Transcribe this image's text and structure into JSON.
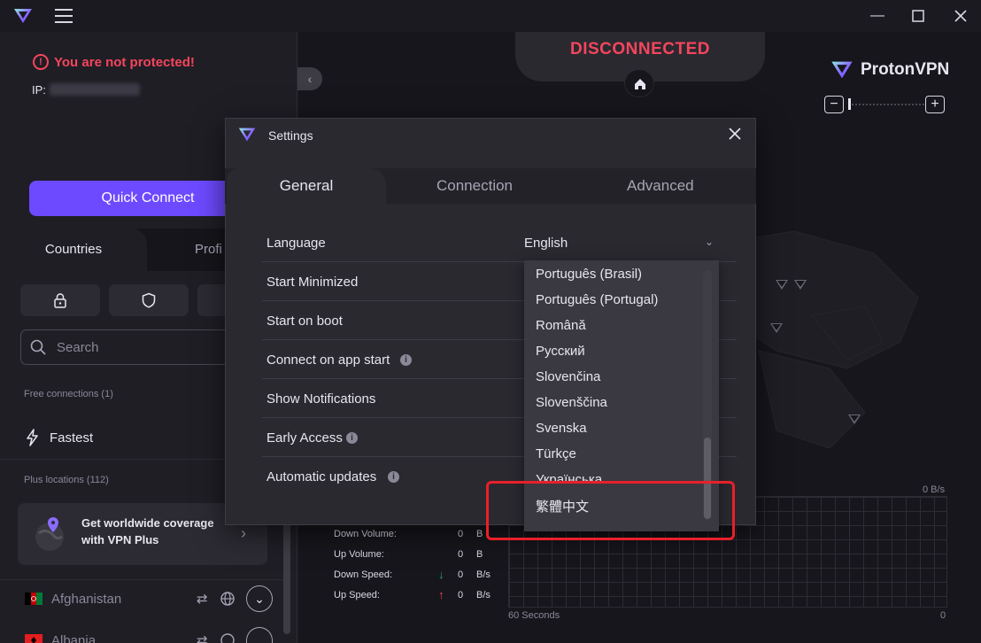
{
  "app": {
    "brand": "ProtonVPN",
    "colors": {
      "accent": "#6d4aff",
      "danger": "#f5455c",
      "highlight": "#e8202a"
    }
  },
  "window": {
    "minimize_icon": "minimize-icon",
    "maximize_icon": "maximize-icon",
    "close_icon": "close-icon"
  },
  "sidebar": {
    "warning": "You are not protected!",
    "ip_label": "IP:",
    "quick_connect": "Quick Connect",
    "tabs": [
      {
        "label": "Countries",
        "active": true
      },
      {
        "label": "Profiles",
        "display": "Profi",
        "active": false
      }
    ],
    "filters": [
      "lock-icon",
      "shield-icon",
      "filter-icon"
    ],
    "search_placeholder": "Search",
    "free_section": "Free connections (1)",
    "fastest": "Fastest",
    "plus_section": "Plus locations (112)",
    "upsell": {
      "line1": "Get worldwide coverage",
      "line2": "with VPN Plus"
    },
    "countries": [
      {
        "name": "Afghanistan",
        "flag": "af"
      },
      {
        "name": "Albania",
        "flag": "al"
      }
    ]
  },
  "map": {
    "status": "DISCONNECTED",
    "zoom_out": "−",
    "zoom_in": "+",
    "stats": [
      {
        "label": "Down Volume:",
        "value": "0",
        "unit": "B"
      },
      {
        "label": "Up Volume:",
        "value": "0",
        "unit": "B"
      },
      {
        "label": "Down Speed:",
        "value": "0",
        "unit": "B/s",
        "arrow": "↓"
      },
      {
        "label": "Up Speed:",
        "value": "0",
        "unit": "B/s",
        "arrow": "↑"
      }
    ],
    "graph": {
      "top_right": "0 B/s",
      "bottom_left": "60 Seconds",
      "bottom_right": "0"
    }
  },
  "settings": {
    "title": "Settings",
    "tabs": [
      {
        "label": "General",
        "active": true
      },
      {
        "label": "Connection",
        "active": false
      },
      {
        "label": "Advanced",
        "active": false
      }
    ],
    "rows": [
      {
        "label": "Language",
        "info": false
      },
      {
        "label": "Start Minimized",
        "info": false
      },
      {
        "label": "Start on boot",
        "info": false
      },
      {
        "label": "Connect on app start",
        "info": true
      },
      {
        "label": "Show Notifications",
        "info": false
      },
      {
        "label": "Early Access",
        "info": true
      },
      {
        "label": "Automatic updates",
        "info": true
      }
    ],
    "language": {
      "selected": "English",
      "options_visible": [
        "Português (Brasil)",
        "Português (Portugal)",
        "Română",
        "Русский",
        "Slovenčina",
        "Slovenščina",
        "Svenska",
        "Türkçe",
        "Українська",
        "繁體中文"
      ]
    }
  }
}
